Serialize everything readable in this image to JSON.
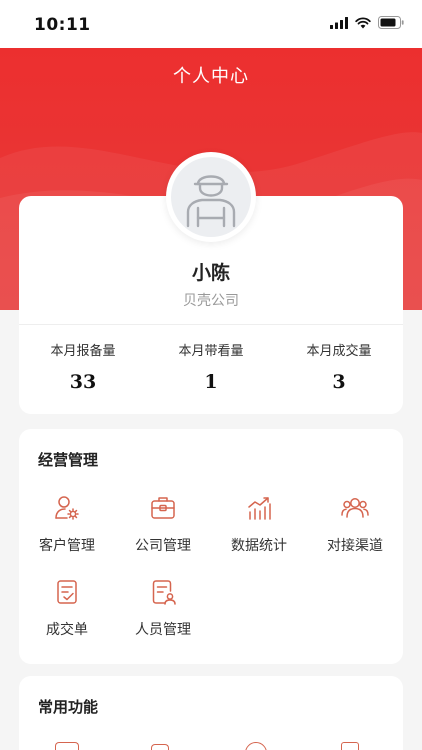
{
  "status_bar": {
    "time": "10:11",
    "icons": [
      "signal-icon",
      "wifi-icon",
      "battery-icon"
    ]
  },
  "header": {
    "title": "个人中心",
    "background_color": "#eb3232"
  },
  "profile": {
    "name": "小陈",
    "company": "贝壳公司",
    "avatar_icon": "user-avatar-icon",
    "stats": [
      {
        "label": "本月报备量",
        "value": "33"
      },
      {
        "label": "本月带看量",
        "value": "1"
      },
      {
        "label": "本月成交量",
        "value": "3"
      }
    ]
  },
  "business_section": {
    "title": "经营管理",
    "items": [
      {
        "label": "客户管理",
        "icon": "customer-icon"
      },
      {
        "label": "公司管理",
        "icon": "company-icon"
      },
      {
        "label": "数据统计",
        "icon": "statistics-icon"
      },
      {
        "label": "对接渠道",
        "icon": "channel-icon"
      },
      {
        "label": "成交单",
        "icon": "deal-order-icon"
      },
      {
        "label": "人员管理",
        "icon": "staff-icon"
      }
    ]
  },
  "common_section": {
    "title": "常用功能"
  },
  "colors": {
    "accent": "#eb3232",
    "icon_tint": "#d5654f"
  }
}
